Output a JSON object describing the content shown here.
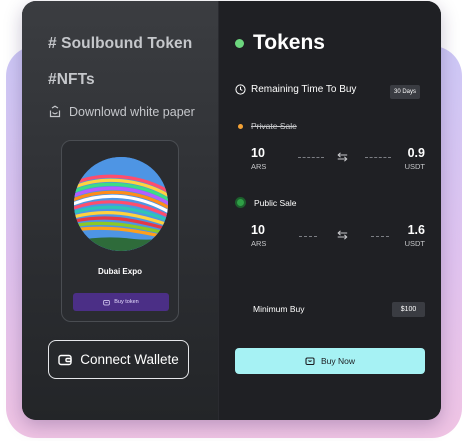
{
  "left_panel": {
    "tag_1": "# Soulbound Token",
    "tag_2": "#NFTs",
    "download_label": "Downlowd white paper",
    "nft_card": {
      "name": "Dubai Expo",
      "button_label": "Buy token"
    },
    "connect_button_label": "Connect Wallete"
  },
  "right_panel": {
    "title": "Tokens",
    "remaining_label": "Remaining Time To Buy",
    "remaining_value": "30 Days",
    "private_sale": {
      "label": "Private Sale",
      "from_amount": "10",
      "from_currency": "ARS",
      "to_amount": "0.9",
      "to_currency": "USDT"
    },
    "public_sale": {
      "label": "Public Sale",
      "from_amount": "10",
      "from_currency": "ARS",
      "to_amount": "1.6",
      "to_currency": "USDT"
    },
    "minimum_buy_label": "Minimum Buy",
    "minimum_buy_value": "$100",
    "buy_now_label": "Buy Now"
  },
  "colors": {
    "accent_cyan": "#a6f2f4",
    "button_purple": "#4b2f86",
    "status_green": "#6cd67e",
    "status_orange": "#f4a236"
  },
  "icons": [
    "clock-icon",
    "wallet-icon",
    "download-icon",
    "swap-arrows-icon"
  ]
}
